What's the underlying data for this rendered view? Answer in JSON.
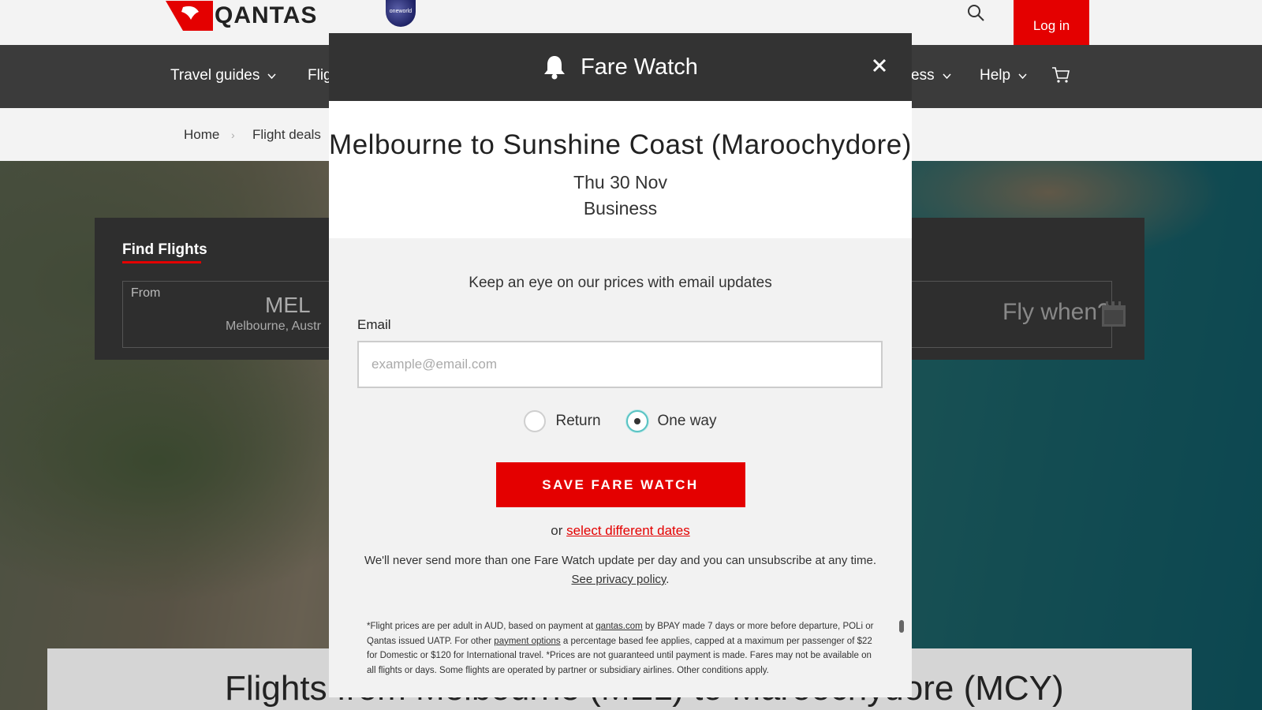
{
  "header": {
    "brand": "QANTAS",
    "alliance": "oneworld",
    "login_label": "Log in",
    "colors": {
      "brand_red": "#e40000",
      "nav_bg": "#3b3b3b"
    }
  },
  "nav": {
    "items": [
      {
        "label": "Travel guides"
      },
      {
        "label": "Flig"
      },
      {
        "label": "ess"
      },
      {
        "label": "Help"
      }
    ]
  },
  "breadcrumb": [
    "Home",
    "Flight deals"
  ],
  "finder": {
    "tab_label": "Find Flights",
    "from_label": "From",
    "from_code": "MEL",
    "from_city": "Melbourne, Austr",
    "when_placeholder": "Fly when?"
  },
  "results": {
    "title": "Flights from Melbourne (MEL) to Maroochydore (MCY)"
  },
  "modal": {
    "title": "Fare Watch",
    "route": "Melbourne to Sunshine Coast (Maroochydore)",
    "date": "Thu 30 Nov",
    "cabin": "Business",
    "intro": "Keep an eye on our prices with email updates",
    "email_label": "Email",
    "email_value": "",
    "email_placeholder": "example@email.com",
    "trip_options": [
      {
        "label": "Return",
        "selected": false
      },
      {
        "label": "One way",
        "selected": true
      }
    ],
    "save_label": "SAVE FARE WATCH",
    "alt_prefix": "or",
    "alt_link": "select different dates",
    "notice_text": "We'll never send more than one Fare Watch update per day and you can unsubscribe at any time.",
    "privacy_link": "See privacy policy",
    "fineprint": {
      "t1": "*Flight prices are per adult in AUD, based on payment at ",
      "link1": "qantas.com",
      "t2": " by BPAY made 7 days or more before departure, POLi or Qantas issued UATP. For other ",
      "link2": "payment options",
      "t3": " a percentage based fee applies, capped at a maximum per passenger of $22 for Domestic or $120 for International travel. *Prices are not guaranteed until payment is made. Fares may not be available on all flights or days. Some flights are operated by partner or subsidiary airlines. Other conditions apply."
    }
  }
}
